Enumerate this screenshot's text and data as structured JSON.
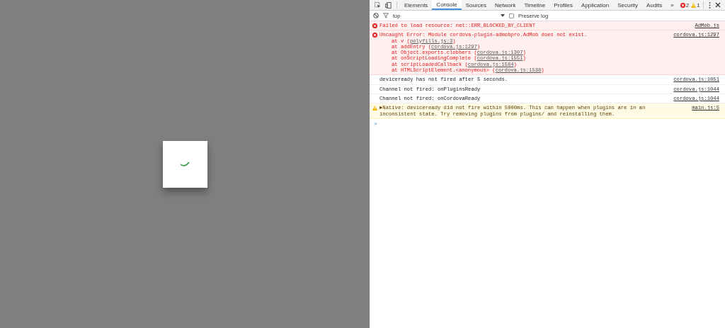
{
  "devtools": {
    "tabs": [
      {
        "label": "Elements",
        "selected": false
      },
      {
        "label": "Console",
        "selected": true
      },
      {
        "label": "Sources",
        "selected": false
      },
      {
        "label": "Network",
        "selected": false
      },
      {
        "label": "Timeline",
        "selected": false
      },
      {
        "label": "Profiles",
        "selected": false
      },
      {
        "label": "Application",
        "selected": false
      },
      {
        "label": "Security",
        "selected": false
      },
      {
        "label": "Audits",
        "selected": false
      }
    ],
    "more_tabs": "»",
    "error_count": "2",
    "warning_count": "1",
    "filter": {
      "context": "top",
      "preserve_log": {
        "label": "Preserve log",
        "checked": false
      }
    },
    "messages": [
      {
        "kind": "error",
        "text": "Failed to load resource: net::ERR_BLOCKED_BY_CLIENT",
        "source": "AdMob.js"
      },
      {
        "kind": "error",
        "text": "Uncaught Error: Module cordova-plugin-admobpro.AdMob does not exist.",
        "source": "cordova.js:1297",
        "stack": [
          {
            "prefix": "at v (",
            "link": "polyfills.js:3",
            "suffix": ")"
          },
          {
            "prefix": "at addEntry (",
            "link": "cordova.js:1297",
            "suffix": ")"
          },
          {
            "prefix": "at Object.exports.clobbers (",
            "link": "cordova.js:1307",
            "suffix": ")"
          },
          {
            "prefix": "at onScriptLoadingComplete (",
            "link": "cordova.js:1551",
            "suffix": ")"
          },
          {
            "prefix": "at scriptLoadedCallback (",
            "link": "cordova.js:1584",
            "suffix": ")"
          },
          {
            "prefix": "at HTMLScriptElement.<anonymous> (",
            "link": "cordova.js:1538",
            "suffix": ")"
          }
        ]
      },
      {
        "kind": "log",
        "text": "deviceready has not fired after 5 seconds.",
        "source": "cordova.js:1051"
      },
      {
        "kind": "log",
        "text": "Channel not fired: onPluginsReady",
        "source": "cordova.js:1044"
      },
      {
        "kind": "log",
        "text": "Channel not fired: onCordovaReady",
        "source": "cordova.js:1044"
      },
      {
        "kind": "warning",
        "text": "►Native: deviceready did not fire within 5000ms. This can happen when plugins are in an inconsistent state. Try removing plugins from plugins/ and reinstalling them.",
        "source": "main.js:5"
      }
    ],
    "prompt": ">"
  }
}
